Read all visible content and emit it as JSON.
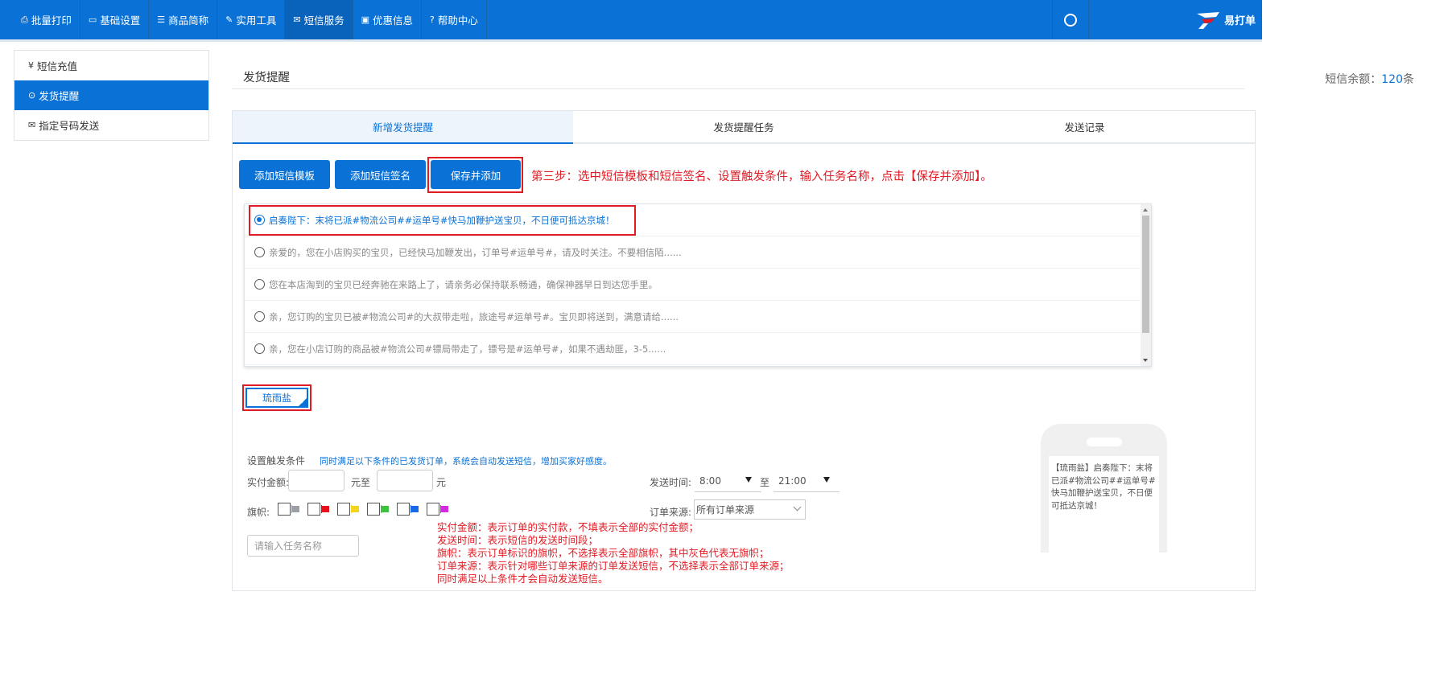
{
  "nav": {
    "items": [
      {
        "label": "批量打印",
        "icon": "print-icon"
      },
      {
        "label": "基础设置",
        "icon": "monitor-icon"
      },
      {
        "label": "商品简称",
        "icon": "list-icon"
      },
      {
        "label": "实用工具",
        "icon": "wrench-icon"
      },
      {
        "label": "短信服务",
        "icon": "mail-icon",
        "active": true
      },
      {
        "label": "优惠信息",
        "icon": "ticket-icon"
      },
      {
        "label": "帮助中心",
        "icon": "help-icon"
      }
    ],
    "brand": "易打单"
  },
  "sidebar": {
    "items": [
      {
        "label": "短信充值",
        "icon": "yen-icon"
      },
      {
        "label": "发货提醒",
        "icon": "clock-icon",
        "active": true
      },
      {
        "label": "指定号码发送",
        "icon": "mail-icon"
      }
    ]
  },
  "page": {
    "title": "发货提醒",
    "balance_prefix": "短信余额：",
    "balance_value": "120",
    "balance_suffix": "条"
  },
  "tabs": [
    "新增发货提醒",
    "发货提醒任务",
    "发送记录"
  ],
  "buttons": {
    "add_template": "添加短信模板",
    "add_signature": "添加短信签名",
    "save_add": "保存并添加"
  },
  "step_note": "第三步：选中短信模板和短信签名、设置触发条件，输入任务名称，点击【保存并添加】。",
  "templates": [
    {
      "text": "启奏陛下：末将已派#物流公司##运单号#快马加鞭护送宝贝，不日便可抵达京城！",
      "selected": true
    },
    {
      "text": "亲爱的，您在小店购买的宝贝，已经快马加鞭发出，订单号#运单号#，请及时关注。不要相信陌......",
      "selected": false
    },
    {
      "text": "您在本店淘到的宝贝已经奔驰在来路上了，请亲务必保持联系畅通，确保神器早日到达您手里。",
      "selected": false
    },
    {
      "text": "亲，您订购的宝贝已被#物流公司#的大叔带走啦，旅途号#运单号#。宝贝即将送到，满意请给......",
      "selected": false
    },
    {
      "text": "亲，您在小店订购的商品被#物流公司#镖局带走了，镖号是#运单号#，如果不遇劫匪，3-5......",
      "selected": false
    }
  ],
  "signature": "琉雨盐",
  "conditions": {
    "label": "设置触发条件",
    "hint": "同时满足以下条件的已发货订单，系统会自动发送短信，增加买家好感度。",
    "amount_label": "实付金额:",
    "amount_mid": "元至",
    "amount_end": "元",
    "send_time_label": "发送时间:",
    "time_from": "8:00",
    "time_to_label": "至",
    "time_to": "21:00",
    "flag_label": "旗帜:",
    "flags": [
      "#9aa0a6",
      "#e8111b",
      "#f3d51e",
      "#3cc43c",
      "#1769e8",
      "#d42be0"
    ],
    "source_label": "订单来源:",
    "source_value": "所有订单来源",
    "task_placeholder": "请输入任务名称"
  },
  "notes": [
    "实付金额：表示订单的实付款，不填表示全部的实付金额；",
    "发送时间：表示短信的发送时间段；",
    "旗帜：表示订单标识的旗帜，不选择表示全部旗帜，其中灰色代表无旗帜；",
    "订单来源：表示针对哪些订单来源的订单发送短信，不选择表示全部订单来源；",
    "同时满足以上条件才会自动发送短信。"
  ],
  "preview": "【琉雨盐】启奏陛下：末将已派#物流公司##运单号#快马加鞭护送宝贝，不日便可抵达京城！"
}
